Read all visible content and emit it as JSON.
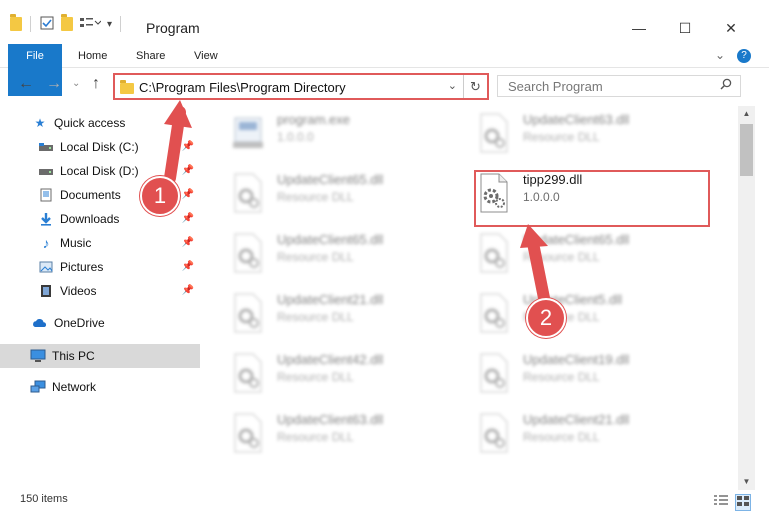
{
  "window": {
    "title": "Program",
    "minimize": "—",
    "maximize": "☐",
    "close": "✕",
    "help": "?",
    "expand": "⌄"
  },
  "ribbon": {
    "tabs": [
      "File",
      "Home",
      "Share",
      "View"
    ]
  },
  "nav": {
    "back": "←",
    "forward": "→",
    "recent": "⌄",
    "up": "↑"
  },
  "address": {
    "path": "C:\\Program Files\\Program Directory",
    "dropdown": "⌄",
    "refresh": "↻"
  },
  "search": {
    "placeholder": "Search Program"
  },
  "sidebar": {
    "items": [
      {
        "label": "Quick access",
        "icon": "star-icon",
        "pinned": false
      },
      {
        "label": "Local Disk (C:)",
        "icon": "drive-icon",
        "pinned": true
      },
      {
        "label": "Local Disk (D:)",
        "icon": "drive-icon",
        "pinned": true
      },
      {
        "label": "Documents",
        "icon": "documents-icon",
        "pinned": true
      },
      {
        "label": "Downloads",
        "icon": "downloads-icon",
        "pinned": true
      },
      {
        "label": "Music",
        "icon": "music-icon",
        "pinned": true
      },
      {
        "label": "Pictures",
        "icon": "pictures-icon",
        "pinned": true
      },
      {
        "label": "Videos",
        "icon": "videos-icon",
        "pinned": true
      },
      {
        "label": "OneDrive",
        "icon": "cloud-icon",
        "pinned": false
      },
      {
        "label": "This PC",
        "icon": "computer-icon",
        "pinned": false,
        "selected": true
      },
      {
        "label": "Network",
        "icon": "network-icon",
        "pinned": false
      }
    ]
  },
  "files": [
    {
      "name": "program.exe",
      "subtitle": "1.0.0.0",
      "kind": "exe",
      "highlighted": false
    },
    {
      "name": "UpdateClient63.dll",
      "subtitle": "Resource DLL",
      "kind": "dll",
      "highlighted": false
    },
    {
      "name": "UpdateClient65.dll",
      "subtitle": "Resource DLL",
      "kind": "dll",
      "highlighted": false
    },
    {
      "name": "tipp299.dll",
      "subtitle": "1.0.0.0",
      "kind": "dll",
      "highlighted": true
    },
    {
      "name": "UpdateClient65.dll",
      "subtitle": "Resource DLL",
      "kind": "dll",
      "highlighted": false
    },
    {
      "name": "UpdateClient65.dll",
      "subtitle": "Resource DLL",
      "kind": "dll",
      "highlighted": false
    },
    {
      "name": "UpdateClient21.dll",
      "subtitle": "Resource DLL",
      "kind": "dll",
      "highlighted": false
    },
    {
      "name": "UpdateClient5.dll",
      "subtitle": "Resource DLL",
      "kind": "dll",
      "highlighted": false
    },
    {
      "name": "UpdateClient42.dll",
      "subtitle": "Resource DLL",
      "kind": "dll",
      "highlighted": false
    },
    {
      "name": "UpdateClient19.dll",
      "subtitle": "Resource DLL",
      "kind": "dll",
      "highlighted": false
    },
    {
      "name": "UpdateClient63.dll",
      "subtitle": "Resource DLL",
      "kind": "dll",
      "highlighted": false
    },
    {
      "name": "UpdateClient21.dll",
      "subtitle": "Resource DLL",
      "kind": "dll",
      "highlighted": false
    }
  ],
  "status": {
    "item_count": "150 items"
  },
  "annotations": {
    "step1": "1",
    "step2": "2",
    "color": "#e15050"
  }
}
